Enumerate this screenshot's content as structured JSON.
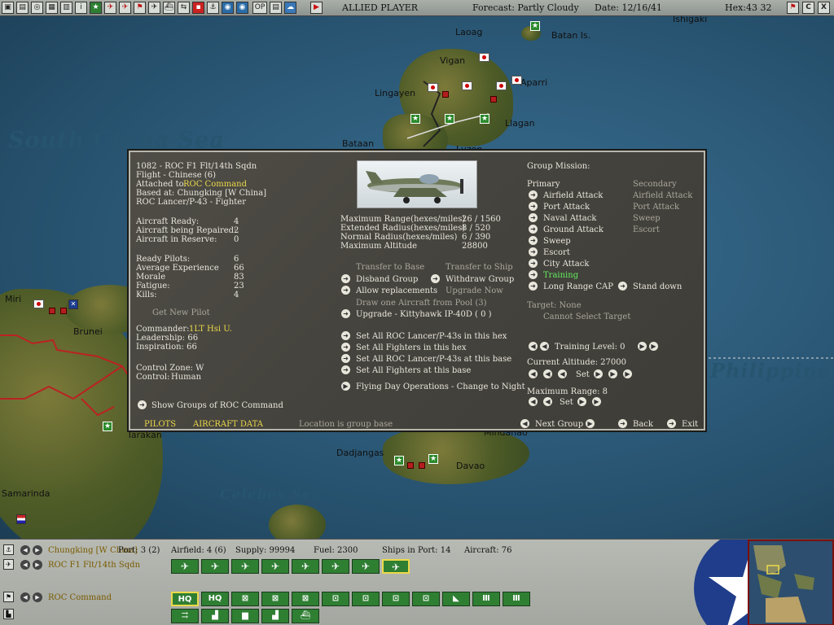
{
  "topbar": {
    "side": "ALLIED PLAYER",
    "forecast": "Forecast: Partly Cloudy",
    "date": "Date: 12/16/41",
    "hex": "Hex:43 32",
    "icons": [
      "save-icon",
      "document-icon",
      "report-icon",
      "list-icon",
      "info-icon",
      "star-icon",
      "aircraft-icon",
      "aircraft2-icon",
      "flag-icon",
      "plane-flight-icon",
      "ship-icon",
      "swap-icon",
      "globe-icon",
      "globe2-icon",
      "op-icon",
      "map-icon",
      "cloud-icon",
      "play-icon"
    ],
    "op_label": "OP",
    "right_icons": [
      "flag-icon",
      "c-icon",
      "close-icon"
    ],
    "c_label": "C",
    "x_label": "X"
  },
  "map": {
    "labels": [
      "Ishigaki",
      "Laoag",
      "Batan Is.",
      "Vigan",
      "Aparri",
      "Lingayen",
      "Llagan",
      "Bataan",
      "Luzon",
      "Miri",
      "Brunei",
      "Tarakan",
      "Samarinda",
      "Dadjangas",
      "Davao",
      "Mindanao"
    ],
    "seas": [
      "South China Sea",
      "Celebes Sea",
      "Philippine"
    ]
  },
  "dialog": {
    "header": {
      "line1": "1082 - ROC F1 Flt/14th Sqdn",
      "line2": "Flight - Chinese (6)",
      "attached_label": "Attached to:",
      "attached_value": "ROC Command",
      "based": "Based at: Chungking [W China]",
      "aircraft": "ROC Lancer/P-43 - Fighter"
    },
    "status": [
      {
        "label": "Aircraft Ready:",
        "value": "4"
      },
      {
        "label": "Aircraft being Repaired:",
        "value": "2"
      },
      {
        "label": "Aircraft in Reserve:",
        "value": "0"
      }
    ],
    "pilots": [
      {
        "label": "Ready Pilots:",
        "value": "6"
      },
      {
        "label": "Average Experience",
        "value": "66"
      },
      {
        "label": "Morale",
        "value": "83"
      },
      {
        "label": "Fatigue:",
        "value": "23"
      },
      {
        "label": "Kills:",
        "value": "4"
      }
    ],
    "get_new_pilot": "Get New Pilot",
    "commander_label": "Commander:",
    "commander_value": "1LT Hsi U.",
    "leadership": "Leadership: 66",
    "inspiration": "Inspiration: 66",
    "control_zone": "Control Zone: W",
    "control_label": "Control:",
    "control_value": "Human",
    "show_groups": "Show Groups of ROC Command",
    "tab_pilots": "PILOTS",
    "tab_aircraft": "AIRCRAFT DATA",
    "location_note": "Location is group base",
    "ranges": [
      {
        "label": "Maximum Range(hexes/miles)",
        "value": "26 / 1560"
      },
      {
        "label": "Extended Radius(hexes/miles)",
        "value": "8 / 520"
      },
      {
        "label": "Normal Radius(hexes/miles)",
        "value": "6 / 390"
      },
      {
        "label": "Maximum Altitude",
        "value": "28800"
      }
    ],
    "actions": {
      "transfer_base": "Transfer to Base",
      "transfer_ship": "Transfer to Ship",
      "disband": "Disband Group",
      "withdraw": "Withdraw Group",
      "allow_repl": "Allow replacements",
      "upgrade_now": "Upgrade Now",
      "draw_one": "Draw one Aircraft from Pool (3)",
      "upgrade_to": "Upgrade - Kittyhawk IP-40D ( 0 )",
      "set_all_1": "Set All ROC Lancer/P-43s in this hex",
      "set_all_2": "Set All Fighters in this hex",
      "set_all_3": "Set All ROC Lancer/P-43s at this base",
      "set_all_4": "Set All Fighters at this base",
      "flying_day": "Flying Day Operations - Change to Night"
    },
    "mission": {
      "title": "Group Mission:",
      "primary_label": "Primary",
      "secondary_label": "Secondary",
      "primary": [
        "Airfield Attack",
        "Port Attack",
        "Naval Attack",
        "Ground Attack",
        "Sweep",
        "Escort",
        "City Attack",
        "Training",
        "Long Range CAP"
      ],
      "secondary": [
        "Airfield Attack",
        "Port Attack",
        "Sweep",
        "Escort"
      ],
      "stand_down": "Stand down",
      "target": "Target: None",
      "cannot_select": "Cannot Select Target",
      "training_level": "Training Level: 0",
      "current_altitude": "Current Altitude: 27000",
      "set_label": "Set",
      "max_range": "Maximum Range: 8",
      "next_group": "Next Group",
      "back": "Back",
      "exit": "Exit"
    }
  },
  "bottom": {
    "base_name": "Chungking [W China]",
    "port": "Port: 3 (2)",
    "airfield": "Airfield: 4 (6)",
    "supply": "Supply: 99994",
    "fuel": "Fuel: 2300",
    "ships": "Ships in Port: 14",
    "aircraft": "Aircraft: 76",
    "group_name": "ROC F1 Flt/14th Sqdn",
    "command": "ROC Command",
    "hq1": "HQ",
    "hq2": "HQ"
  },
  "colors": {
    "highlight": "#ecd94a",
    "training": "#5ff05f",
    "unit_green": "#2f7f33",
    "japan_red": "#c00000"
  }
}
